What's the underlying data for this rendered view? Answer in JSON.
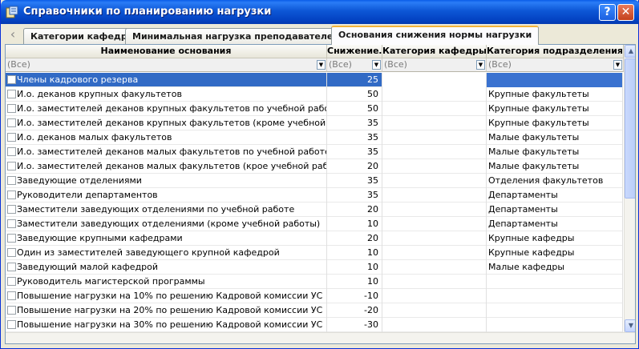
{
  "window": {
    "title": "Справочники по планированию нагрузки",
    "help_label": "?",
    "close_label": "✕"
  },
  "tabs": [
    {
      "label": "Категории кафедр"
    },
    {
      "label": "Минимальная нагрузка преподавателей"
    },
    {
      "label": "Основания снижения нормы нагрузки",
      "active": true
    }
  ],
  "columns": {
    "name": "Наименование основания",
    "reduction": "Снижение…",
    "dept_category": "Категория кафедры",
    "division_category": "Категория подразделения…"
  },
  "filters": {
    "name": "(Все)",
    "reduction": "(Все)",
    "dept_category": "(Все)",
    "division_category": "(Все)"
  },
  "rows": [
    {
      "name": "Члены кадрового резерва",
      "reduction": "25",
      "dept": "",
      "division": ""
    },
    {
      "name": "И.о. деканов крупных факультетов",
      "reduction": "50",
      "dept": "",
      "division": "Крупные факультеты"
    },
    {
      "name": "И.о. заместителей деканов крупных факультетов по учебной работе",
      "reduction": "50",
      "dept": "",
      "division": "Крупные факультеты"
    },
    {
      "name": "И.о. заместителей деканов крупных факультетов (кроме учебной работы)",
      "reduction": "35",
      "dept": "",
      "division": "Крупные факультеты"
    },
    {
      "name": "И.о. деканов малых факультетов",
      "reduction": "35",
      "dept": "",
      "division": "Малые факультеты"
    },
    {
      "name": "И.о. заместителей деканов малых факультетов по учебной работе",
      "reduction": "35",
      "dept": "",
      "division": "Малые факультеты"
    },
    {
      "name": "И.о. заместителей деканов малых факультетов (крое учебной работы)",
      "reduction": "20",
      "dept": "",
      "division": "Малые факультеты"
    },
    {
      "name": "Заведующие отделениями",
      "reduction": "35",
      "dept": "",
      "division": "Отделения факультетов"
    },
    {
      "name": "Руководители департаментов",
      "reduction": "35",
      "dept": "",
      "division": "Департаменты"
    },
    {
      "name": "Заместители заведующих отделениями по учебной работе",
      "reduction": "20",
      "dept": "",
      "division": "Департаменты"
    },
    {
      "name": "Заместители заведующих отделениями (кроме учебной работы)",
      "reduction": "10",
      "dept": "",
      "division": "Департаменты"
    },
    {
      "name": "Заведующие крупными кафедрами",
      "reduction": "20",
      "dept": "",
      "division": "Крупные кафедры"
    },
    {
      "name": "Один из заместителей заведующего крупной кафедрой",
      "reduction": "10",
      "dept": "",
      "division": "Крупные кафедры"
    },
    {
      "name": "Заведующий малой кафедрой",
      "reduction": "10",
      "dept": "",
      "division": "Малые кафедры"
    },
    {
      "name": "Руководитель магистерской программы",
      "reduction": "10",
      "dept": "",
      "division": ""
    },
    {
      "name": "Повышение нагрузки на 10% по решению Кадровой комиссии УС",
      "reduction": "-10",
      "dept": "",
      "division": ""
    },
    {
      "name": "Повышение нагрузки на 20% по решению Кадровой комиссии УС",
      "reduction": "-20",
      "dept": "",
      "division": ""
    },
    {
      "name": "Повышение нагрузки на 30% по решению Кадровой комиссии УС",
      "reduction": "-30",
      "dept": "",
      "division": ""
    }
  ],
  "selected_row": 0,
  "colors": {
    "title_bar": "#0a5de8",
    "selection": "#316ac5",
    "active_tab_accent": "#f4b43a"
  }
}
